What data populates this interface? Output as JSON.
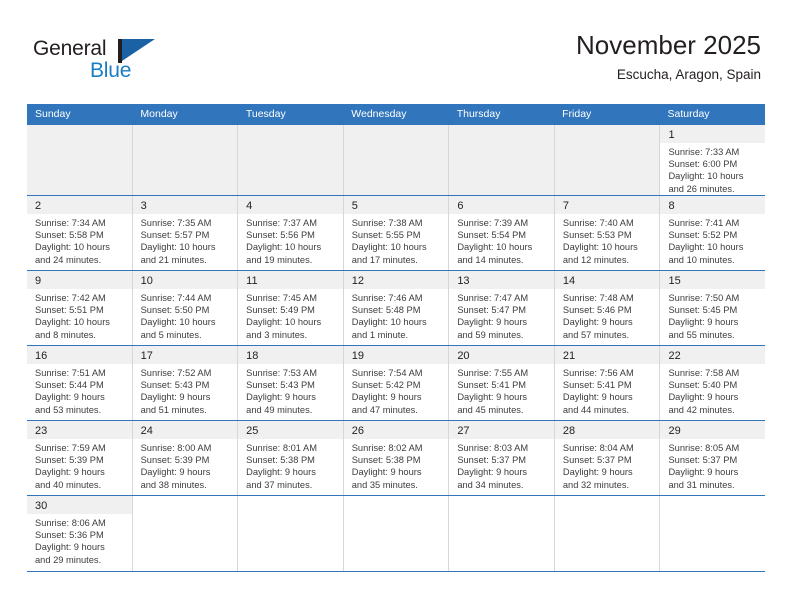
{
  "brand": {
    "name_top": "General",
    "name_bottom": "Blue",
    "accent_color": "#1b7ec2",
    "flag_color": "#1b62a5"
  },
  "header": {
    "title": "November 2025",
    "subtitle": "Escucha, Aragon, Spain"
  },
  "calendar": {
    "header_color": "#3176bc",
    "daynum_bg": "#f0f0f0",
    "weekday_headers": [
      "Sunday",
      "Monday",
      "Tuesday",
      "Wednesday",
      "Thursday",
      "Friday",
      "Saturday"
    ],
    "weeks": [
      [
        {
          "empty": true
        },
        {
          "empty": true
        },
        {
          "empty": true
        },
        {
          "empty": true
        },
        {
          "empty": true
        },
        {
          "empty": true
        },
        {
          "day": "1",
          "sunrise": "Sunrise: 7:33 AM",
          "sunset": "Sunset: 6:00 PM",
          "daylight1": "Daylight: 10 hours",
          "daylight2": "and 26 minutes."
        }
      ],
      [
        {
          "day": "2",
          "sunrise": "Sunrise: 7:34 AM",
          "sunset": "Sunset: 5:58 PM",
          "daylight1": "Daylight: 10 hours",
          "daylight2": "and 24 minutes."
        },
        {
          "day": "3",
          "sunrise": "Sunrise: 7:35 AM",
          "sunset": "Sunset: 5:57 PM",
          "daylight1": "Daylight: 10 hours",
          "daylight2": "and 21 minutes."
        },
        {
          "day": "4",
          "sunrise": "Sunrise: 7:37 AM",
          "sunset": "Sunset: 5:56 PM",
          "daylight1": "Daylight: 10 hours",
          "daylight2": "and 19 minutes."
        },
        {
          "day": "5",
          "sunrise": "Sunrise: 7:38 AM",
          "sunset": "Sunset: 5:55 PM",
          "daylight1": "Daylight: 10 hours",
          "daylight2": "and 17 minutes."
        },
        {
          "day": "6",
          "sunrise": "Sunrise: 7:39 AM",
          "sunset": "Sunset: 5:54 PM",
          "daylight1": "Daylight: 10 hours",
          "daylight2": "and 14 minutes."
        },
        {
          "day": "7",
          "sunrise": "Sunrise: 7:40 AM",
          "sunset": "Sunset: 5:53 PM",
          "daylight1": "Daylight: 10 hours",
          "daylight2": "and 12 minutes."
        },
        {
          "day": "8",
          "sunrise": "Sunrise: 7:41 AM",
          "sunset": "Sunset: 5:52 PM",
          "daylight1": "Daylight: 10 hours",
          "daylight2": "and 10 minutes."
        }
      ],
      [
        {
          "day": "9",
          "sunrise": "Sunrise: 7:42 AM",
          "sunset": "Sunset: 5:51 PM",
          "daylight1": "Daylight: 10 hours",
          "daylight2": "and 8 minutes."
        },
        {
          "day": "10",
          "sunrise": "Sunrise: 7:44 AM",
          "sunset": "Sunset: 5:50 PM",
          "daylight1": "Daylight: 10 hours",
          "daylight2": "and 5 minutes."
        },
        {
          "day": "11",
          "sunrise": "Sunrise: 7:45 AM",
          "sunset": "Sunset: 5:49 PM",
          "daylight1": "Daylight: 10 hours",
          "daylight2": "and 3 minutes."
        },
        {
          "day": "12",
          "sunrise": "Sunrise: 7:46 AM",
          "sunset": "Sunset: 5:48 PM",
          "daylight1": "Daylight: 10 hours",
          "daylight2": "and 1 minute."
        },
        {
          "day": "13",
          "sunrise": "Sunrise: 7:47 AM",
          "sunset": "Sunset: 5:47 PM",
          "daylight1": "Daylight: 9 hours",
          "daylight2": "and 59 minutes."
        },
        {
          "day": "14",
          "sunrise": "Sunrise: 7:48 AM",
          "sunset": "Sunset: 5:46 PM",
          "daylight1": "Daylight: 9 hours",
          "daylight2": "and 57 minutes."
        },
        {
          "day": "15",
          "sunrise": "Sunrise: 7:50 AM",
          "sunset": "Sunset: 5:45 PM",
          "daylight1": "Daylight: 9 hours",
          "daylight2": "and 55 minutes."
        }
      ],
      [
        {
          "day": "16",
          "sunrise": "Sunrise: 7:51 AM",
          "sunset": "Sunset: 5:44 PM",
          "daylight1": "Daylight: 9 hours",
          "daylight2": "and 53 minutes."
        },
        {
          "day": "17",
          "sunrise": "Sunrise: 7:52 AM",
          "sunset": "Sunset: 5:43 PM",
          "daylight1": "Daylight: 9 hours",
          "daylight2": "and 51 minutes."
        },
        {
          "day": "18",
          "sunrise": "Sunrise: 7:53 AM",
          "sunset": "Sunset: 5:43 PM",
          "daylight1": "Daylight: 9 hours",
          "daylight2": "and 49 minutes."
        },
        {
          "day": "19",
          "sunrise": "Sunrise: 7:54 AM",
          "sunset": "Sunset: 5:42 PM",
          "daylight1": "Daylight: 9 hours",
          "daylight2": "and 47 minutes."
        },
        {
          "day": "20",
          "sunrise": "Sunrise: 7:55 AM",
          "sunset": "Sunset: 5:41 PM",
          "daylight1": "Daylight: 9 hours",
          "daylight2": "and 45 minutes."
        },
        {
          "day": "21",
          "sunrise": "Sunrise: 7:56 AM",
          "sunset": "Sunset: 5:41 PM",
          "daylight1": "Daylight: 9 hours",
          "daylight2": "and 44 minutes."
        },
        {
          "day": "22",
          "sunrise": "Sunrise: 7:58 AM",
          "sunset": "Sunset: 5:40 PM",
          "daylight1": "Daylight: 9 hours",
          "daylight2": "and 42 minutes."
        }
      ],
      [
        {
          "day": "23",
          "sunrise": "Sunrise: 7:59 AM",
          "sunset": "Sunset: 5:39 PM",
          "daylight1": "Daylight: 9 hours",
          "daylight2": "and 40 minutes."
        },
        {
          "day": "24",
          "sunrise": "Sunrise: 8:00 AM",
          "sunset": "Sunset: 5:39 PM",
          "daylight1": "Daylight: 9 hours",
          "daylight2": "and 38 minutes."
        },
        {
          "day": "25",
          "sunrise": "Sunrise: 8:01 AM",
          "sunset": "Sunset: 5:38 PM",
          "daylight1": "Daylight: 9 hours",
          "daylight2": "and 37 minutes."
        },
        {
          "day": "26",
          "sunrise": "Sunrise: 8:02 AM",
          "sunset": "Sunset: 5:38 PM",
          "daylight1": "Daylight: 9 hours",
          "daylight2": "and 35 minutes."
        },
        {
          "day": "27",
          "sunrise": "Sunrise: 8:03 AM",
          "sunset": "Sunset: 5:37 PM",
          "daylight1": "Daylight: 9 hours",
          "daylight2": "and 34 minutes."
        },
        {
          "day": "28",
          "sunrise": "Sunrise: 8:04 AM",
          "sunset": "Sunset: 5:37 PM",
          "daylight1": "Daylight: 9 hours",
          "daylight2": "and 32 minutes."
        },
        {
          "day": "29",
          "sunrise": "Sunrise: 8:05 AM",
          "sunset": "Sunset: 5:37 PM",
          "daylight1": "Daylight: 9 hours",
          "daylight2": "and 31 minutes."
        }
      ],
      [
        {
          "day": "30",
          "sunrise": "Sunrise: 8:06 AM",
          "sunset": "Sunset: 5:36 PM",
          "daylight1": "Daylight: 9 hours",
          "daylight2": "and 29 minutes."
        },
        {
          "blank": true
        },
        {
          "blank": true
        },
        {
          "blank": true
        },
        {
          "blank": true
        },
        {
          "blank": true
        },
        {
          "blank": true
        }
      ]
    ]
  }
}
